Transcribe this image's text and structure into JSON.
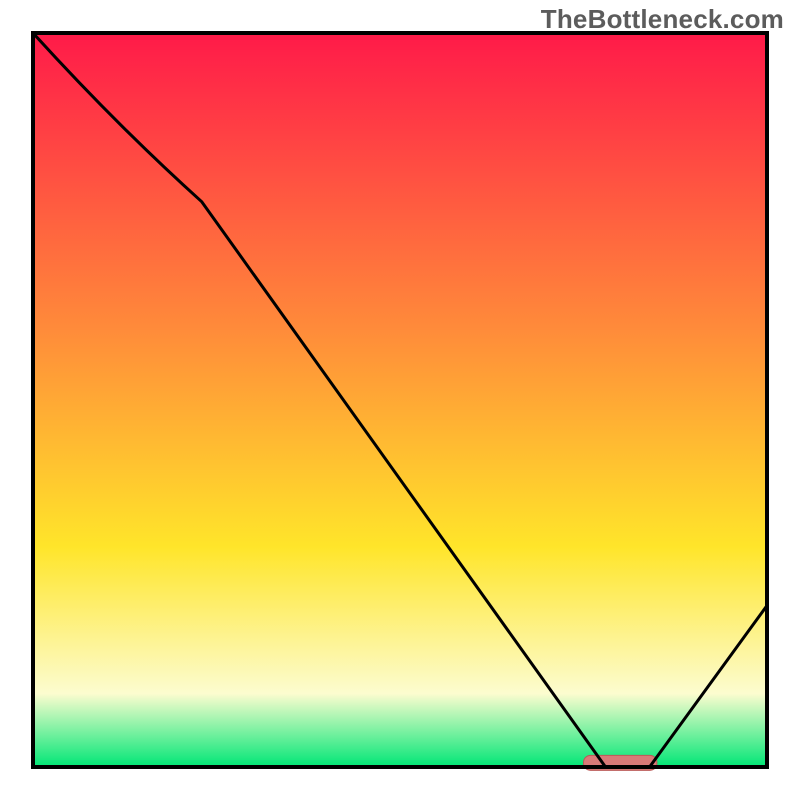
{
  "watermark": "TheBottleneck.com",
  "colors": {
    "frame": "#000000",
    "curve": "#000000",
    "pill_fill": "#d97a78",
    "pill_stroke": "#bb5a58",
    "gradient_top": "#ff1a49",
    "gradient_mid1": "#ff8a3a",
    "gradient_mid2": "#ffe52a",
    "gradient_pale": "#fcfccf",
    "gradient_green": "#00e676"
  },
  "chart_data": {
    "type": "line",
    "title": "",
    "xlabel": "",
    "ylabel": "",
    "xlim": [
      0,
      100
    ],
    "ylim": [
      0,
      100
    ],
    "x": [
      0,
      23,
      78,
      84,
      100
    ],
    "values": [
      100,
      77,
      0,
      0,
      22
    ],
    "highlight_region": {
      "x_start": 75,
      "x_end": 85,
      "y": 0.5
    },
    "notes": "V-shaped bottleneck curve over vertical red→green gradient; trough at ~x=78–84; pink pill marks optimal range."
  }
}
